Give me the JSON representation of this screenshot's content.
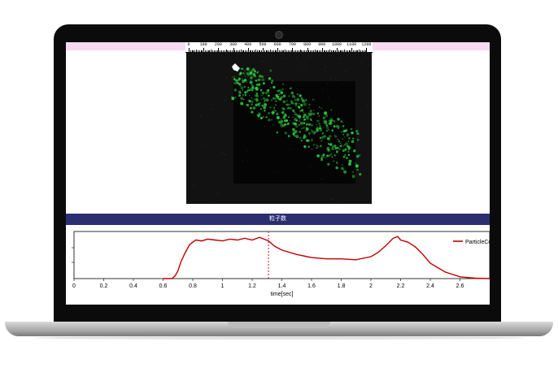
{
  "ruler": {
    "labels": [
      "0",
      "100",
      "200",
      "300",
      "400",
      "500",
      "600",
      "700",
      "800",
      "900",
      "1000",
      "1100",
      "1200"
    ]
  },
  "header": {
    "title": "粒子数"
  },
  "chart_data": {
    "type": "line",
    "xlabel": "time[sec]",
    "ylabel": "",
    "xlim": [
      0,
      2.8
    ],
    "xticks": [
      "0",
      "0.2",
      "0.4",
      "0.6",
      "0.8",
      "1",
      "1.2",
      "1.4",
      "1.6",
      "1.8",
      "2",
      "2.2",
      "2.4",
      "2.6"
    ],
    "cursor_x": 1.31,
    "series": [
      {
        "name": "ParticleCo",
        "color": "#c00000",
        "x": [
          0.6,
          0.66,
          0.68,
          0.7,
          0.72,
          0.75,
          0.78,
          0.82,
          0.86,
          0.9,
          0.95,
          1.0,
          1.05,
          1.1,
          1.15,
          1.2,
          1.25,
          1.28,
          1.31,
          1.35,
          1.4,
          1.5,
          1.6,
          1.7,
          1.8,
          1.9,
          2.0,
          2.05,
          2.1,
          2.15,
          2.18,
          2.2,
          2.22,
          2.25,
          2.3,
          2.35,
          2.4,
          2.5,
          2.6,
          2.7,
          2.8
        ],
        "y": [
          0.0,
          0.0,
          0.06,
          0.18,
          0.38,
          0.6,
          0.78,
          0.88,
          0.86,
          0.9,
          0.88,
          0.86,
          0.9,
          0.88,
          0.92,
          0.88,
          0.94,
          0.9,
          0.86,
          0.74,
          0.65,
          0.55,
          0.48,
          0.45,
          0.45,
          0.43,
          0.5,
          0.6,
          0.75,
          0.92,
          0.96,
          0.88,
          0.86,
          0.83,
          0.72,
          0.55,
          0.35,
          0.15,
          0.04,
          0.01,
          0.0
        ]
      }
    ],
    "legend_position": "top-right"
  },
  "colors": {
    "header_bg": "#2b2f72",
    "ruler_bar": "#f7d9f1",
    "series": "#c00000",
    "particles": "#2ecc40"
  }
}
